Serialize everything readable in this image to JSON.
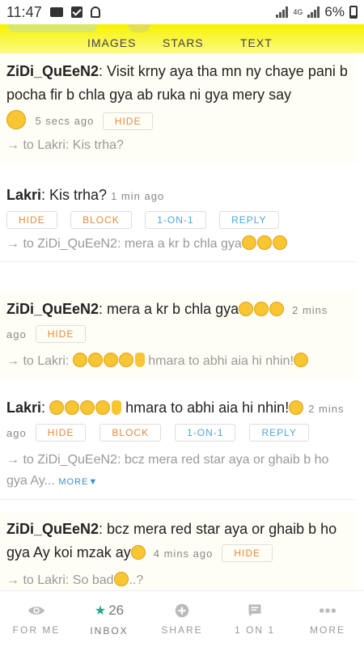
{
  "status": {
    "time": "11:47",
    "battery": "6%",
    "network": "4G"
  },
  "tabs": [
    {
      "label": "IMAGES"
    },
    {
      "label": "STARS"
    },
    {
      "label": "TEXT"
    }
  ],
  "posts": [
    {
      "user": "ZiDi_QuEeN2",
      "text": ": Visit krny aya tha mn ny chaye pani b pocha fir b chla gya ab ruka ni gya mery say",
      "time": "5 secs ago",
      "buttons": [
        "HIDE"
      ],
      "reply_to": "→ to Lakri: Kis trha?"
    },
    {
      "user": "Lakri",
      "text": ": Kis trha?",
      "time": "1 min ago",
      "buttons": [
        "HIDE",
        "BLOCK",
        "1-ON-1",
        "REPLY"
      ],
      "reply_to": "→ to ZiDi_QuEeN2: mera a kr b chla gya"
    },
    {
      "user": "ZiDi_QuEeN2",
      "text": ": mera a kr b chla gya",
      "time": "2 mins ago",
      "buttons": [
        "HIDE"
      ],
      "reply_to": "→ to Lakri:",
      "reply_tail": "hmara to abhi aia hi nhin!"
    },
    {
      "user": "Lakri",
      "text": "hmara to abhi aia hi nhin!",
      "time": "2 mins ago",
      "buttons": [
        "HIDE",
        "BLOCK",
        "1-ON-1",
        "REPLY"
      ],
      "reply_to": "→ to ZiDi_QuEeN2: bcz mera red star aya or ghaib b ho gya Ay...",
      "more": "MORE▼"
    },
    {
      "user": "ZiDi_QuEeN2",
      "text": ": bcz mera red star aya or ghaib b ho gya Ay koi mzak ay",
      "time": "4 mins ago",
      "buttons": [
        "HIDE"
      ],
      "reply_to": "→ to Lakri: So bad",
      "reply_tail": "..?"
    }
  ],
  "nav": [
    {
      "label": "FOR ME",
      "icon": "eye-icon"
    },
    {
      "label": "INBOX",
      "icon": "star-icon",
      "count": "26"
    },
    {
      "label": "SHARE",
      "icon": "plus-circle-icon"
    },
    {
      "label": "1 ON 1",
      "icon": "chat-bubble-icon"
    },
    {
      "label": "MORE",
      "icon": "dots-icon"
    }
  ]
}
